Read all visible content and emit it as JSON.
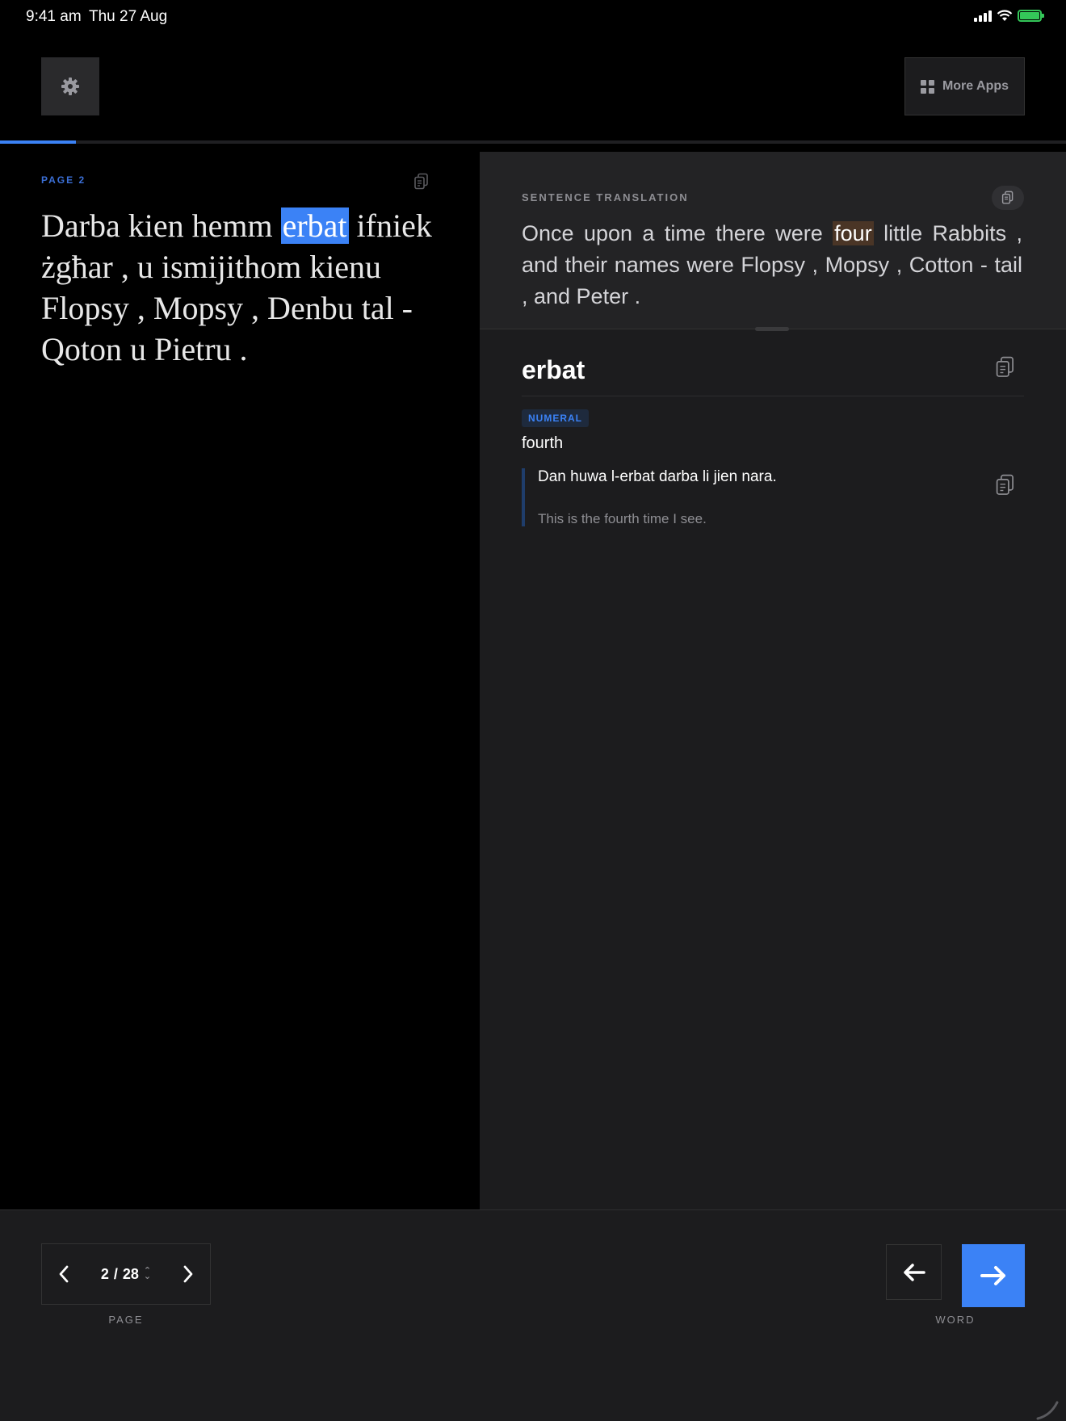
{
  "status_bar": {
    "time": "9:41 am",
    "date": "Thu 27 Aug"
  },
  "header": {
    "more_apps_label": "More Apps"
  },
  "progress": {
    "fraction": 0.0714
  },
  "source": {
    "page_label": "PAGE  2",
    "text_before": "Darba kien hemm ",
    "highlight_word": "erbat",
    "text_after": " ifniek żgħar , u ismijithom kienu Flopsy , Mopsy , Denbu tal - Qoton u Pietru ."
  },
  "translation": {
    "label": "SENTENCE TRANSLATION",
    "text_before": "Once upon a time there were ",
    "highlight_word": "four",
    "text_after": " little Rabbits , and their names were Flopsy , Mopsy , Cotton - tail , and Peter ."
  },
  "word_detail": {
    "word": "erbat",
    "part_of_speech": "NUMERAL",
    "meaning": "fourth",
    "example_sentence": "Dan huwa l-erbat darba li jien nara.",
    "example_translation": "This is the fourth time I see."
  },
  "page_nav": {
    "current": "2",
    "separator": "/",
    "total": "28",
    "caption": "PAGE"
  },
  "word_nav": {
    "caption": "WORD"
  },
  "colors": {
    "accent": "#3b82f6",
    "highlight_translation": "#4a3526",
    "battery": "#34c759"
  },
  "icons": [
    "gear-icon",
    "grid-icon",
    "copy-icon",
    "chevron-left-icon",
    "chevron-right-icon",
    "arrow-left-icon",
    "arrow-right-icon",
    "signal-icon",
    "wifi-icon",
    "battery-icon"
  ]
}
